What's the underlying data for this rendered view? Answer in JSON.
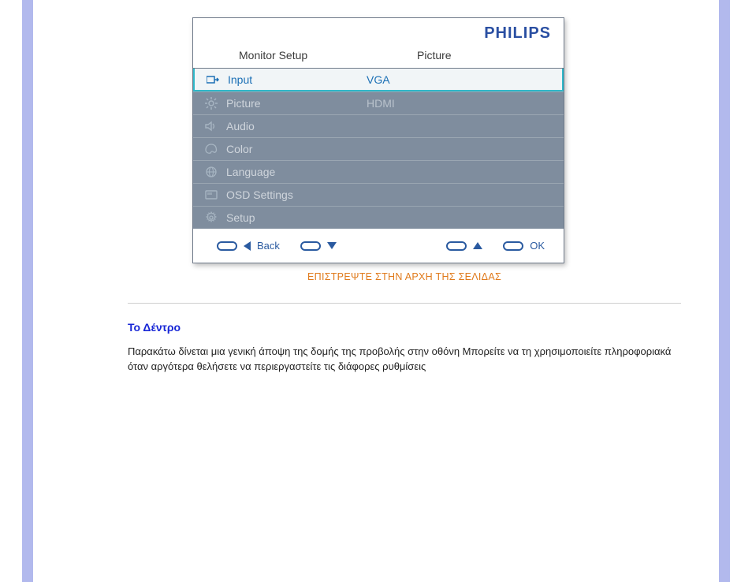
{
  "brand": "PHILIPS",
  "osd": {
    "left_header": "Monitor Setup",
    "right_header": "Picture",
    "menu": [
      {
        "label": "Input",
        "selected": true
      },
      {
        "label": "Picture",
        "selected": false
      },
      {
        "label": "Audio",
        "selected": false
      },
      {
        "label": "Color",
        "selected": false
      },
      {
        "label": "Language",
        "selected": false
      },
      {
        "label": "OSD Settings",
        "selected": false
      },
      {
        "label": "Setup",
        "selected": false
      }
    ],
    "submenu": [
      {
        "label": "VGA",
        "selected": true
      },
      {
        "label": "HDMI",
        "selected": false
      },
      {
        "label": "",
        "selected": false
      },
      {
        "label": "",
        "selected": false
      },
      {
        "label": "",
        "selected": false
      },
      {
        "label": "",
        "selected": false
      },
      {
        "label": "",
        "selected": false
      }
    ],
    "footer": {
      "back": "Back",
      "ok": "OK"
    }
  },
  "toplink": "ΕΠΙΣΤΡΕΨΤΕ ΣΤΗΝ ΑΡΧΗ ΤΗΣ ΣΕΛΙΔΑΣ",
  "section_title": "Το Δέντρο",
  "paragraph": "Παρακάτω δίνεται μια γενική άποψη της δομής της προβολής στην οθόνη  Μπορείτε να τη χρησιμοποιείτε πληροφοριακά όταν αργότερα θελήσετε να περιεργαστείτε τις διάφορες ρυθμίσεις"
}
